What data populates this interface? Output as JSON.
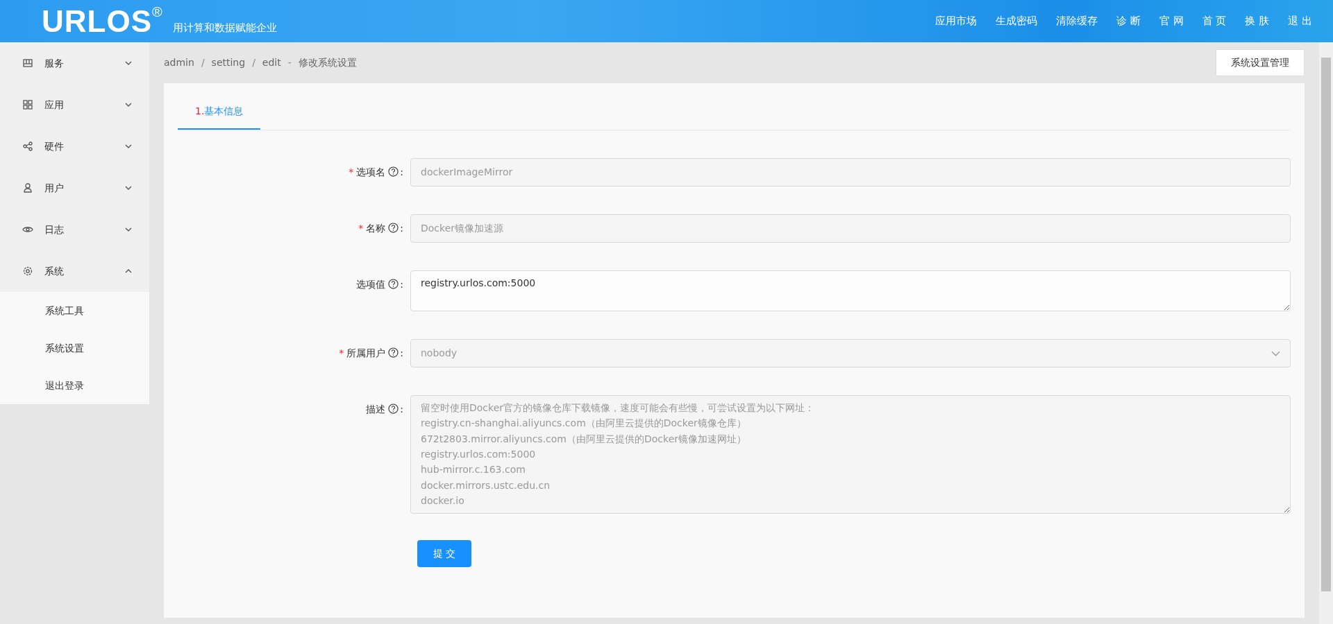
{
  "header": {
    "logo": "URLOS$^{®}$",
    "tagline": "用计算和数据赋能企业",
    "nav": [
      "应用市场",
      "生成密码",
      "清除缓存",
      "诊 断",
      "官 网",
      "首 页",
      "换 肤",
      "退 出"
    ]
  },
  "sidebar": {
    "items": [
      {
        "label": "服务",
        "expanded": false
      },
      {
        "label": "应用",
        "expanded": false
      },
      {
        "label": "硬件",
        "expanded": false
      },
      {
        "label": "用户",
        "expanded": false
      },
      {
        "label": "日志",
        "expanded": false
      },
      {
        "label": "系统",
        "expanded": true,
        "children": [
          {
            "label": "系统工具"
          },
          {
            "label": "系统设置"
          },
          {
            "label": "退出登录"
          }
        ]
      }
    ]
  },
  "breadcrumb": [
    "admin",
    "setting",
    "edit"
  ],
  "breadcrumb_separators": [
    "/",
    "/"
  ],
  "title_separator": "-",
  "page_title": "修改系统设置",
  "manage_button": "系统设置管理",
  "tabs": [
    {
      "number": "1.",
      "label": "基本信息",
      "selected": true
    }
  ],
  "form": {
    "fields": [
      {
        "kind": "input",
        "required_mark": "*",
        "label": "选项名",
        "colon": ":",
        "disabled": true,
        "value": "dockerImageMirror"
      },
      {
        "kind": "input",
        "required_mark": "*",
        "label": "名称",
        "colon": ":",
        "disabled": true,
        "value": "Docker镜像加速源"
      },
      {
        "kind": "textarea",
        "label": "选项值",
        "colon": ":",
        "disabled": false,
        "value": "registry.urlos.com:5000"
      },
      {
        "kind": "select",
        "required_mark": "*",
        "label": "所属用户",
        "colon": ":",
        "disabled": true,
        "value": "nobody"
      },
      {
        "kind": "textarea",
        "label": "描述",
        "colon": ":",
        "disabled": true,
        "value": "留空时使用Docker官方的镜像仓库下载镜像，速度可能会有些慢，可尝试设置为以下网址：\nregistry.cn-shanghai.aliyuncs.com（由阿里云提供的Docker镜像仓库）\n672t2803.mirror.aliyuncs.com（由阿里云提供的Docker镜像加速网址）\nregistry.urlos.com:5000\nhub-mirror.c.163.com\ndocker.mirrors.ustc.edu.cn\ndocker.io"
      }
    ],
    "submit": "提 交"
  }
}
